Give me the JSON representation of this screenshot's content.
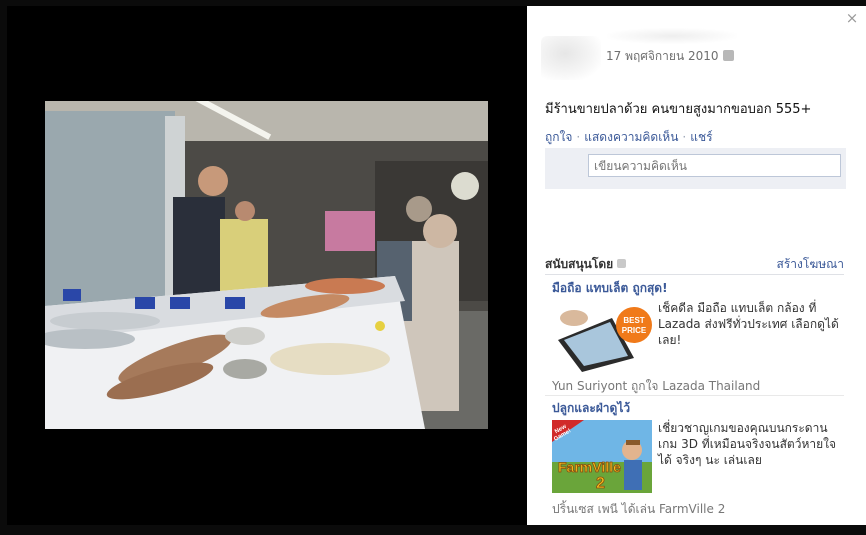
{
  "post": {
    "date": "17 พฤศจิกายน 2010",
    "caption": "มีร้านขายปลาด้วย คนขายสูงมากขอบอก 555+",
    "actions": [
      "ถูกใจ",
      "แสดงความคิดเห็น",
      "แชร์"
    ],
    "comment_placeholder": "เขียนความคิดเห็น"
  },
  "sponsored": {
    "title": "สนับสนุนโดย",
    "create_ad": "สร้างโฆษณา"
  },
  "ads": [
    {
      "title": "มือถือ แทบเล็ต ถูกสุด!",
      "badge": "BEST PRICE",
      "body": "เช็คดีล มือถือ แทบเล็ต กล้อง ที่ Lazada ส่งฟรีทั่วประเทศ เลือกดูได้เลย!",
      "social": "Yun Suriyont ถูกใจ Lazada Thailand"
    },
    {
      "title": "ปลูกและฝ่าดูไว้",
      "badge": "New Game!",
      "logo": "FarmVille2",
      "body": "เชี่ยวชาญเกมของคุณบนกระดาน เกม 3D ที่เหมือนจริงจนสัตว์หายใจได้ จริงๆ นะ เล่นเลย",
      "social": "ปริ้นเซส เพนี ได้เล่น FarmVille 2"
    }
  ],
  "close_symbol": "×",
  "colors": {
    "link": "#3b5998",
    "panel": "#ffffff",
    "backdrop": "#000000",
    "comment_area": "#edeff4"
  }
}
